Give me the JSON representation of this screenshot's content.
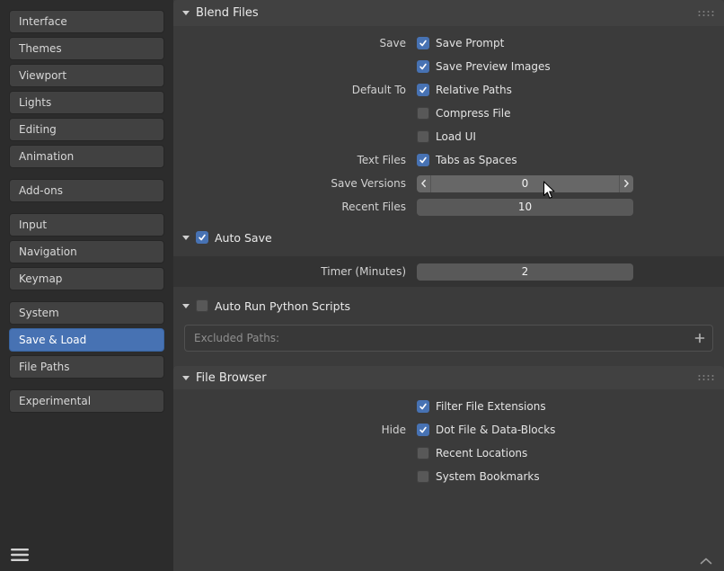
{
  "colors": {
    "accent_blue": "#4772b3",
    "checkbox_on": "#4772b3"
  },
  "sidebar": {
    "active_item": "Save & Load",
    "groups": [
      {
        "items": [
          "Interface",
          "Themes",
          "Viewport",
          "Lights",
          "Editing",
          "Animation"
        ]
      },
      {
        "items": [
          "Add-ons"
        ]
      },
      {
        "items": [
          "Input",
          "Navigation",
          "Keymap"
        ]
      },
      {
        "items": [
          "System",
          "Save & Load",
          "File Paths"
        ]
      },
      {
        "items": [
          "Experimental"
        ]
      }
    ]
  },
  "blend_files": {
    "title": "Blend Files",
    "checks": [
      {
        "label": "Save",
        "text": "Save Prompt",
        "checked": true
      },
      {
        "label": "",
        "text": "Save Preview Images",
        "checked": true
      },
      {
        "label": "Default To",
        "text": "Relative Paths",
        "checked": true
      },
      {
        "label": "",
        "text": "Compress File",
        "checked": false
      },
      {
        "label": "",
        "text": "Load UI",
        "checked": false
      },
      {
        "label": "Text Files",
        "text": "Tabs as Spaces",
        "checked": true
      }
    ],
    "save_versions": {
      "label": "Save Versions",
      "value": "0"
    },
    "recent_files": {
      "label": "Recent Files",
      "value": "10"
    }
  },
  "auto_save": {
    "title": "Auto Save",
    "checked": true,
    "timer": {
      "label": "Timer (Minutes)",
      "value": "2"
    }
  },
  "auto_run": {
    "title": "Auto Run Python Scripts",
    "checked": false,
    "excluded_paths_placeholder": "Excluded Paths:"
  },
  "file_browser": {
    "title": "File Browser",
    "checks": [
      {
        "label": "",
        "text": "Filter File Extensions",
        "checked": true
      },
      {
        "label": "Hide",
        "text": "Dot File & Data-Blocks",
        "checked": true
      },
      {
        "label": "",
        "text": "Recent Locations",
        "checked": false
      },
      {
        "label": "",
        "text": "System Bookmarks",
        "checked": false
      }
    ]
  }
}
